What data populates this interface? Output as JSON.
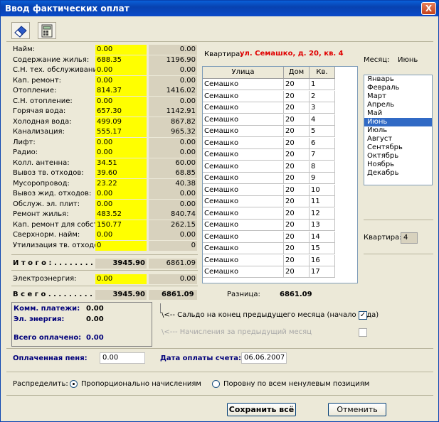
{
  "window": {
    "title": "Ввод фактических оплат",
    "close_glyph": "X"
  },
  "labels": [
    {
      "name": "Найм:",
      "v1": "0.00",
      "v2": "0.00"
    },
    {
      "name": "Содержание жилья:",
      "v1": "688.35",
      "v2": "1196.90"
    },
    {
      "name": "С.Н. тех. обслуживание:",
      "v1": "0.00",
      "v2": "0.00"
    },
    {
      "name": "Кап. ремонт:",
      "v1": "0.00",
      "v2": "0.00"
    },
    {
      "name": "Отопление:",
      "v1": "814.37",
      "v2": "1416.02"
    },
    {
      "name": "С.Н. отопление:",
      "v1": "0.00",
      "v2": "0.00"
    },
    {
      "name": "Горячая вода:",
      "v1": "657.30",
      "v2": "1142.91"
    },
    {
      "name": "Холодная вода:",
      "v1": "499.09",
      "v2": "867.82"
    },
    {
      "name": "Канализация:",
      "v1": "555.17",
      "v2": "965.32"
    },
    {
      "name": "Лифт:",
      "v1": "0.00",
      "v2": "0.00"
    },
    {
      "name": "Радио:",
      "v1": "0.00",
      "v2": "0.00"
    },
    {
      "name": "Колл. антенна:",
      "v1": "34.51",
      "v2": "60.00"
    },
    {
      "name": "Вывоз тв. отходов:",
      "v1": "39.60",
      "v2": "68.85"
    },
    {
      "name": "Мусоропровод:",
      "v1": "23.22",
      "v2": "40.38"
    },
    {
      "name": "Вывоз жид. отходов:",
      "v1": "0.00",
      "v2": "0.00"
    },
    {
      "name": "Обслуж. эл. плит:",
      "v1": "0.00",
      "v2": "0.00"
    },
    {
      "name": "Ремонт жилья:",
      "v1": "483.52",
      "v2": "840.74"
    },
    {
      "name": "Кап. ремонт для собств.:",
      "v1": "150.77",
      "v2": "262.15"
    },
    {
      "name": "Сверхнорм. найм:",
      "v1": "0.00",
      "v2": "0.00"
    },
    {
      "name": "Утилизация тв. отходов:",
      "v1": "0",
      "v2": "0"
    }
  ],
  "totals": {
    "itogo_label": "И т о г о : . . . . . . . . . . .",
    "itogo_v1": "3945.90",
    "itogo_v2": "6861.09",
    "elec_label": "Электроэнергия:",
    "elec_v1": "0.00",
    "elec_v2": "0.00",
    "vsego_label": "В с е г о . . . . . . . . . . . .",
    "vsego_v1": "3945.90",
    "vsego_v2": "6861.09",
    "raznica_label": "Разница:",
    "raznica_value": "6861.09"
  },
  "address": {
    "label": "Квартира:",
    "value": "ул. Семашко, д. 20, кв. 4"
  },
  "grid": {
    "headers": [
      "Улица",
      "Дом",
      "Кв."
    ],
    "rows": [
      [
        "Семашко",
        "20",
        "1"
      ],
      [
        "Семашко",
        "20",
        "2"
      ],
      [
        "Семашко",
        "20",
        "3"
      ],
      [
        "Семашко",
        "20",
        "4"
      ],
      [
        "Семашко",
        "20",
        "5"
      ],
      [
        "Семашко",
        "20",
        "6"
      ],
      [
        "Семашко",
        "20",
        "7"
      ],
      [
        "Семашко",
        "20",
        "8"
      ],
      [
        "Семашко",
        "20",
        "9"
      ],
      [
        "Семашко",
        "20",
        "10"
      ],
      [
        "Семашко",
        "20",
        "11"
      ],
      [
        "Семашко",
        "20",
        "12"
      ],
      [
        "Семашко",
        "20",
        "13"
      ],
      [
        "Семашко",
        "20",
        "14"
      ],
      [
        "Семашко",
        "20",
        "15"
      ],
      [
        "Семашко",
        "20",
        "16"
      ],
      [
        "Семашко",
        "20",
        "17"
      ]
    ]
  },
  "month": {
    "label": "Месяц:",
    "current": "Июнь",
    "options": [
      "Январь",
      "Февраль",
      "Март",
      "Апрель",
      "Май",
      "Июнь",
      "Июль",
      "Август",
      "Сентябрь",
      "Октябрь",
      "Ноябрь",
      "Декабрь"
    ],
    "selected_index": 5
  },
  "apartment": {
    "label": "Квартира:",
    "value": "4"
  },
  "payments": {
    "komm_label": "Комм. платежи:",
    "komm_value": "0.00",
    "el_label": "Эл. энергия:",
    "el_value": "0.00",
    "total_label": "Всего оплачено:",
    "total_value": "0.00"
  },
  "checks": {
    "saldo_label": "\\<-- Сальдо на конец предыдущего месяца (начало года)",
    "saldo_checked": "✓",
    "nachisl_label": "\\<--- Начисления за предыдущий месяц"
  },
  "penalty": {
    "label": "Оплаченная пеня:",
    "value": "0.00"
  },
  "paydate": {
    "label": "Дата оплаты счета:",
    "value": "06.06.2007"
  },
  "distribute": {
    "label": "Распределить:",
    "opt1": "Пропорционально начислениям",
    "opt2": "Поровну по всем ненулевым позициям"
  },
  "buttons": {
    "save": "Сохранить всё",
    "cancel": "Отменить"
  },
  "colors": {
    "yellow": "#ffff00",
    "address_red": "#e00000",
    "selection": "#316ac5"
  }
}
